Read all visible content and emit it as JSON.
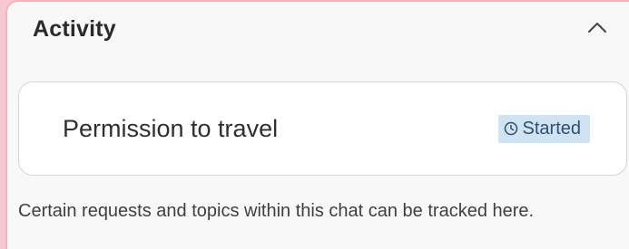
{
  "activity": {
    "title": "Activity",
    "item": {
      "title": "Permission to travel",
      "status": "Started",
      "status_icon": "clock-icon",
      "status_color": "#cfe3f3"
    },
    "note": "Certain requests and topics within this chat can be tracked here."
  },
  "colors": {
    "frame_background": "#f8c8d0",
    "panel_background": "#f8f8f8",
    "card_background": "#ffffff"
  }
}
